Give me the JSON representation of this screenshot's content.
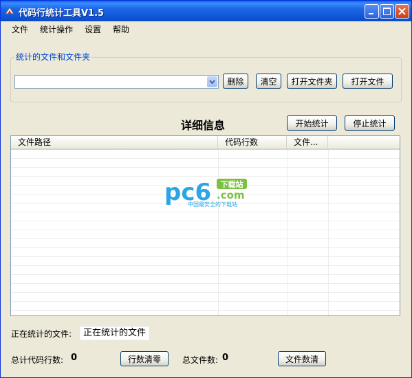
{
  "window": {
    "title": "代码行统计工具V1.5"
  },
  "menu": [
    "文件",
    "统计操作",
    "设置",
    "帮助"
  ],
  "files_group": {
    "title": "统计的文件和文件夹",
    "combo_value": "",
    "buttons": {
      "delete": "删除",
      "clear": "清空",
      "open_folder": "打开文件夹",
      "open_file": "打开文件"
    }
  },
  "details": {
    "title": "详细信息",
    "start_label": "开始统计",
    "stop_label": "停止统计",
    "columns": [
      "文件路径",
      "代码行数",
      "文件..."
    ]
  },
  "watermark": {
    "brand": "pc6",
    "suffix": ".com",
    "tag": "下载站",
    "slogan": "中国最安全的下载站"
  },
  "status": {
    "current_label": "正在统计的文件:",
    "current_value": "正在统计的文件",
    "total_lines_label": "总计代码行数:",
    "total_lines_value": "0",
    "clear_lines_label": "行数清零",
    "total_files_label": "总文件数:",
    "total_files_value": "0",
    "clear_files_label": "文件数清"
  },
  "colors": {
    "titlebar": "#0a5fe8",
    "group_title": "#0046d5",
    "face": "#ece9d8",
    "watermark_blue": "#2aa5e6",
    "watermark_green": "#7cc242"
  }
}
